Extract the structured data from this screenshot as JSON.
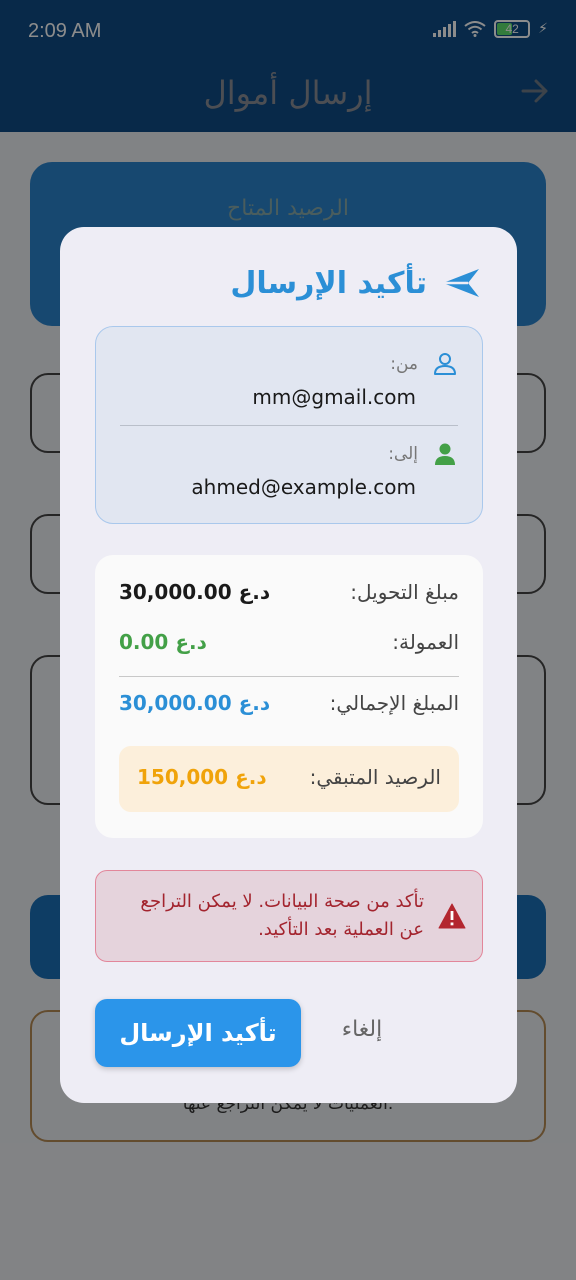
{
  "status_bar": {
    "time": "2:09 AM",
    "battery": "42"
  },
  "app_bar": {
    "title": "إرسال أموال"
  },
  "background": {
    "balance_label": "الرصيد المتاح",
    "note_text": "العمليات لا يمكن التراجع عنها."
  },
  "dialog": {
    "title": "تأكيد الإرسال",
    "from_label": "من:",
    "from_value": "mm@gmail.com",
    "to_label": "إلى:",
    "to_value": "ahmed@example.com",
    "transfer_label": "مبلغ التحويل:",
    "transfer_value": "30,000.00 د.ع",
    "commission_label": "العمولة:",
    "commission_value": "0.00 د.ع",
    "total_label": "المبلغ الإجمالي:",
    "total_value": "30,000.00 د.ع",
    "remaining_label": "الرصيد المتبقي:",
    "remaining_value": "150,000 د.ع",
    "warning_text": "تأكد من صحة البيانات. لا يمكن التراجع عن العملية بعد التأكيد.",
    "confirm_label": "تأكيد الإرسال",
    "cancel_label": "إلغاء"
  },
  "colors": {
    "primary": "#2b95ea",
    "title": "#2b8fd6",
    "commission": "#43a047",
    "total": "#2b8fd6",
    "remaining": "#f0a30a",
    "warning": "#a3242e",
    "from_icon": "#2b8fd6",
    "to_icon": "#43a047"
  },
  "icons": {
    "back": "arrow-right-icon",
    "send": "send-icon",
    "from": "person-outline-icon",
    "to": "person-icon",
    "warning": "warning-triangle-icon"
  }
}
